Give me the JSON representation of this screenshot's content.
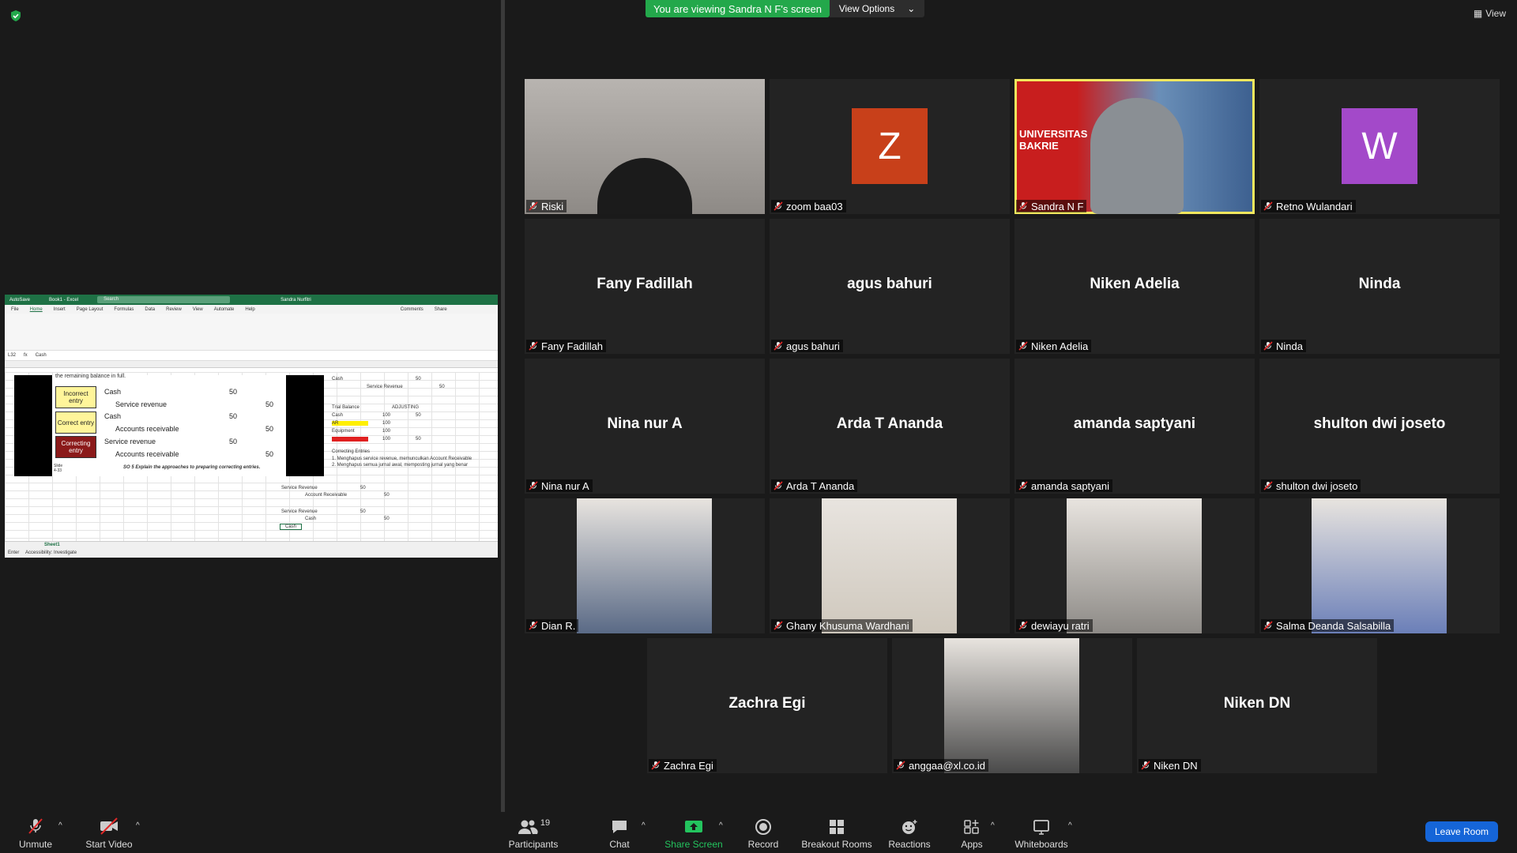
{
  "top_bar": {
    "banner": "You are viewing Sandra N F's screen",
    "view_options": "View Options",
    "view": "View"
  },
  "shared_screen": {
    "excel_title": "Book1 - Excel",
    "search_placeholder": "Search",
    "user": "Sandra Nurfitri",
    "menu": [
      "File",
      "Home",
      "Insert",
      "Page Layout",
      "Formulas",
      "Data",
      "Review",
      "View",
      "Automate",
      "Help"
    ],
    "comments": "Comments",
    "share": "Share",
    "cell_ref": "L32",
    "formula": "Cash",
    "slide": {
      "top_text": "the remaining balance in full.",
      "incorrect_label": "Incorrect entry",
      "correct_label": "Correct entry",
      "correcting_label": "Correcting entry",
      "rows": [
        {
          "account": "Cash",
          "debit": "50",
          "credit": ""
        },
        {
          "account": "Service revenue",
          "debit": "",
          "credit": "50"
        },
        {
          "account": "Cash",
          "debit": "50",
          "credit": ""
        },
        {
          "account": "Accounts receivable",
          "debit": "",
          "credit": "50"
        },
        {
          "account": "Service revenue",
          "debit": "50",
          "credit": ""
        },
        {
          "account": "Accounts receivable",
          "debit": "",
          "credit": "50"
        }
      ],
      "slide_no": "Slide 4-33",
      "so_text": "SO 5  Explain the approaches to preparing correcting entries."
    },
    "side_cells": {
      "cash": "Cash",
      "cash_val": "50",
      "service_revenue": "Service Revenue",
      "sr_val": "50",
      "trial_balance": "Trial Balance",
      "adjusting": "ADJUSTING",
      "tb_rows": [
        {
          "label": "Cash",
          "val": "100",
          "adj": "50"
        },
        {
          "label": "AR",
          "val": "100",
          "adj": ""
        },
        {
          "label": "Equipment",
          "val": "100",
          "adj": ""
        },
        {
          "label": "Service Revenue",
          "val": "100",
          "adj": "50"
        }
      ],
      "correcting_entries": "Correcting Entries",
      "ce1": "1. Menghapus service revenue, memunculkan Account Receivable",
      "ce2": "2. Menghapus semua jurnal awal, memposting jurnal yang benar"
    },
    "lower_cells": [
      {
        "label": "Service Revenue",
        "val": "50"
      },
      {
        "label": "Account Receivable",
        "val": "50"
      },
      {
        "label": "Service Revenue",
        "val": "50"
      },
      {
        "label": "Cash",
        "val": "50"
      }
    ],
    "active_cell": "Cash",
    "sheet_tab": "Sheet1",
    "status_left": "Enter",
    "accessibility": "Accessibility: Investigate"
  },
  "participants_tiles": [
    {
      "name": "Riski",
      "type": "video-dark"
    },
    {
      "name": "zoom baa03",
      "type": "avatar",
      "letter": "Z",
      "color": "#c8401a"
    },
    {
      "name": "Sandra N F",
      "type": "video-active"
    },
    {
      "name": "Retno Wulandari",
      "type": "avatar",
      "letter": "W",
      "color": "#a349c9"
    },
    {
      "name": "Fany Fadillah",
      "type": "name"
    },
    {
      "name": "agus bahuri",
      "type": "name"
    },
    {
      "name": "Niken Adelia",
      "type": "name"
    },
    {
      "name": "Ninda",
      "type": "name"
    },
    {
      "name": "Nina nur A",
      "type": "name"
    },
    {
      "name": "Arda T Ananda",
      "type": "name"
    },
    {
      "name": "amanda saptyani",
      "type": "name"
    },
    {
      "name": "shulton dwi joseto",
      "type": "name"
    },
    {
      "name": "Dian R.",
      "type": "photo"
    },
    {
      "name": "Ghany Khusuma Wardhani",
      "type": "photo"
    },
    {
      "name": "dewiayu ratri",
      "type": "photo"
    },
    {
      "name": "Salma Deanda Salsabilla",
      "type": "photo"
    },
    {
      "name": "Zachra Egi",
      "type": "name"
    },
    {
      "name": "anggaa@xl.co.id",
      "type": "photo"
    },
    {
      "name": "Niken DN",
      "type": "name"
    }
  ],
  "sandra_video_text": "UNIVERSITAS BAKRIE",
  "toolbar": {
    "unmute": "Unmute",
    "start_video": "Start Video",
    "participants": "Participants",
    "participants_count": "19",
    "chat": "Chat",
    "share_screen": "Share Screen",
    "record": "Record",
    "breakout_rooms": "Breakout Rooms",
    "reactions": "Reactions",
    "apps": "Apps",
    "whiteboards": "Whiteboards",
    "leave_room": "Leave Room"
  }
}
